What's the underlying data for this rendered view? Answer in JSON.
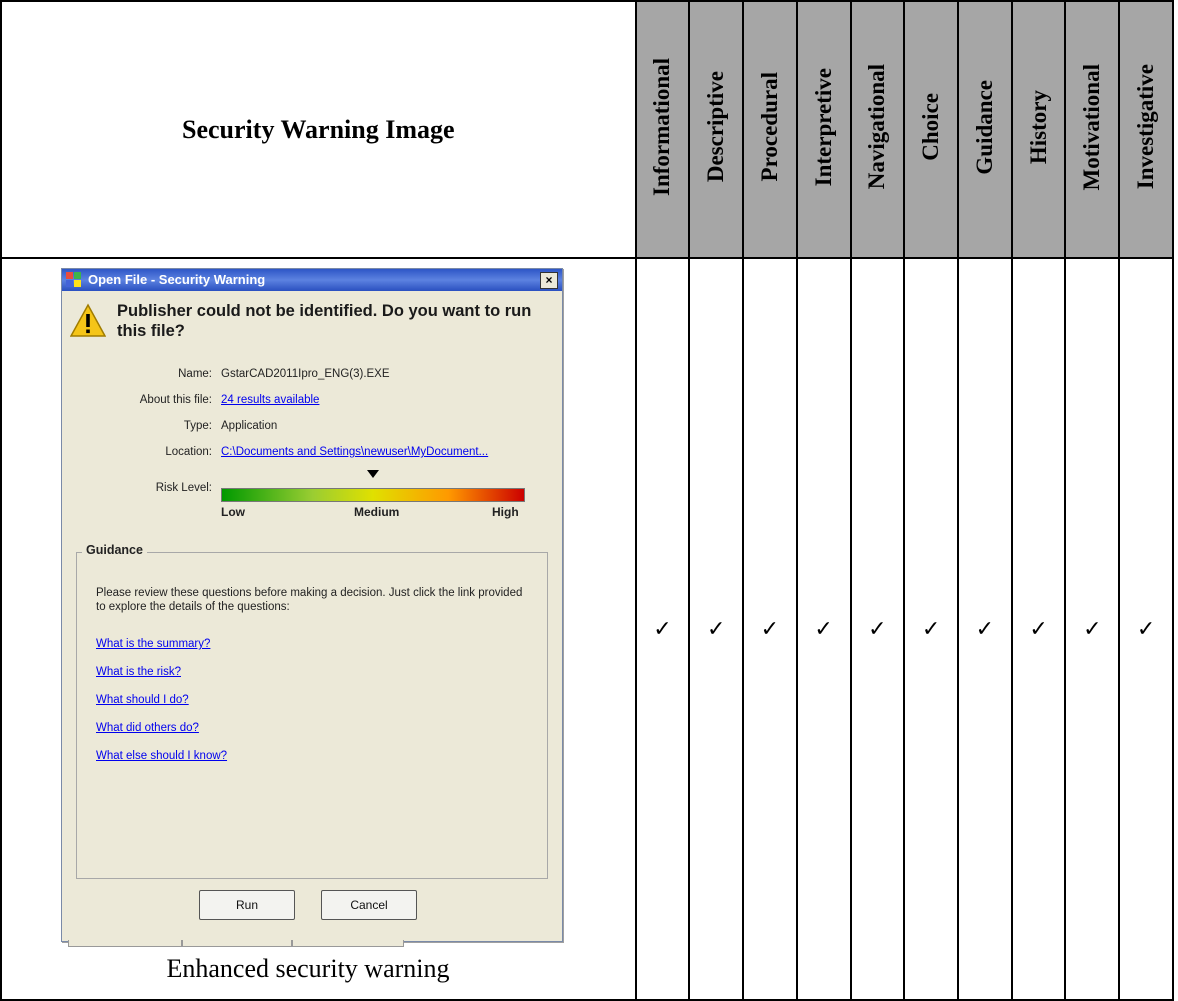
{
  "table": {
    "header_main": "Security Warning Image",
    "categories": [
      "Informational",
      "Descriptive",
      "Procedural",
      "Interpretive",
      "Navigational",
      "Choice",
      "Guidance",
      "History",
      "Motivational",
      "Investigative"
    ],
    "checks": [
      "✓",
      "✓",
      "✓",
      "✓",
      "✓",
      "✓",
      "✓",
      "✓",
      "✓",
      "✓"
    ],
    "caption": "Enhanced security warning"
  },
  "dialog": {
    "title": "Open File - Security Warning",
    "close_glyph": "×",
    "headline": "Publisher could not be identified. Do you want to run this file?",
    "fields": [
      {
        "label": "Name:",
        "value": "GstarCAD2011Ipro_ENG(3).EXE"
      },
      {
        "label": "About this file:",
        "value": "24 results available"
      },
      {
        "label": "Type:",
        "value": "Application"
      },
      {
        "label": "Location:",
        "value": "C:\\Documents and Settings\\newuser\\MyDocument..."
      }
    ],
    "risk": {
      "label": "Risk Level:",
      "low": "Low",
      "medium": "Medium",
      "high": "High",
      "level": 0.5
    },
    "guidance": {
      "title": "Guidance",
      "text": "Please review these questions before making a decision. Just click the link provided to explore the details of the questions:",
      "links": [
        "What is the summary?",
        "What is the risk?",
        "What should I do?",
        "What did others do?",
        "What else should I know?"
      ]
    },
    "buttons": {
      "run": "Run",
      "cancel": "Cancel"
    }
  },
  "colors": {
    "header_fill": "#a6a6a6",
    "title_bar": "#2e56c7",
    "link": "#0000ee",
    "dialog_bg": "#ece9d8"
  }
}
